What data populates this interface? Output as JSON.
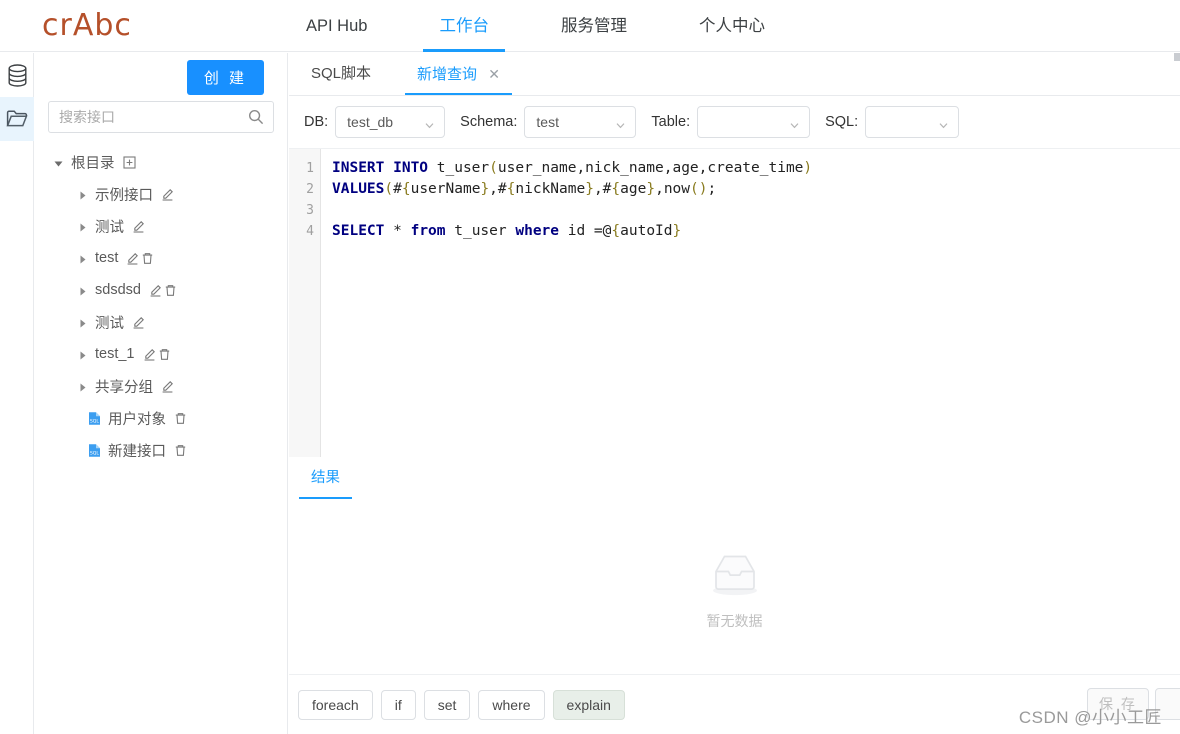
{
  "header": {
    "logo": "crAbc",
    "nav": [
      {
        "label": "API Hub",
        "active": false
      },
      {
        "label": "工作台",
        "active": true
      },
      {
        "label": "服务管理",
        "active": false
      },
      {
        "label": "个人中心",
        "active": false
      }
    ]
  },
  "rail": {
    "items": [
      {
        "icon": "database-icon",
        "active": false
      },
      {
        "icon": "folder-icon",
        "active": true
      }
    ]
  },
  "sidebar": {
    "create_label": "创 建",
    "search": {
      "value": "",
      "placeholder": "搜索接口",
      "icon": "search-icon"
    },
    "tree": [
      {
        "label": "根目录",
        "level": 0,
        "caret": "down",
        "actions": [
          "plus-box-icon"
        ]
      },
      {
        "label": "示例接口",
        "level": 1,
        "caret": "right",
        "actions": [
          "pencil-icon"
        ]
      },
      {
        "label": "测试",
        "level": 1,
        "caret": "right",
        "actions": [
          "pencil-icon"
        ]
      },
      {
        "label": "test",
        "level": 1,
        "caret": "right",
        "actions": [
          "pencil-icon",
          "trash-icon"
        ]
      },
      {
        "label": "sdsdsd",
        "level": 1,
        "caret": "right",
        "actions": [
          "pencil-icon",
          "trash-icon"
        ]
      },
      {
        "label": "测试",
        "level": 1,
        "caret": "right",
        "actions": [
          "pencil-icon"
        ]
      },
      {
        "label": "test_1",
        "level": 1,
        "caret": "right",
        "actions": [
          "pencil-icon",
          "trash-icon"
        ]
      },
      {
        "label": "共享分组",
        "level": 1,
        "caret": "right",
        "actions": [
          "pencil-icon"
        ]
      },
      {
        "label": "用户对象",
        "level": 2,
        "caret": "none",
        "leaf_icon": "sql-file-icon",
        "actions": [
          "trash-icon"
        ]
      },
      {
        "label": "新建接口",
        "level": 2,
        "caret": "none",
        "leaf_icon": "sql-file-icon",
        "actions": [
          "trash-icon"
        ]
      }
    ]
  },
  "main": {
    "tabs": [
      {
        "label": "SQL脚本",
        "active": false,
        "closable": false
      },
      {
        "label": "新增查询",
        "active": true,
        "closable": true,
        "close_icon": "close-icon"
      }
    ],
    "toolbar": {
      "db": {
        "label": "DB:",
        "value": "test_db"
      },
      "schema": {
        "label": "Schema:",
        "value": "test"
      },
      "table": {
        "label": "Table:",
        "value": ""
      },
      "sql": {
        "label": "SQL:",
        "value": ""
      }
    },
    "editor": {
      "line_numbers": [
        "1",
        "2",
        "3",
        "4"
      ],
      "lines": [
        "INSERT INTO t_user(user_name,nick_name,age,create_time)",
        "VALUES(#{userName},#{nickName},#{age},now());",
        "",
        "SELECT * from t_user where id =@{autoId}"
      ]
    },
    "result": {
      "tabs": [
        {
          "label": "结果",
          "active": true
        }
      ],
      "empty_icon": "empty-inbox-icon",
      "empty_text": "暂无数据"
    },
    "bottom": {
      "chips": [
        {
          "label": "foreach",
          "tinted": false
        },
        {
          "label": "if",
          "tinted": false
        },
        {
          "label": "set",
          "tinted": false
        },
        {
          "label": "where",
          "tinted": false
        },
        {
          "label": "explain",
          "tinted": true
        }
      ],
      "save_label": "保 存"
    }
  },
  "watermark": "CSDN @小小工匠",
  "colors": {
    "accent_blue": "#1890ff",
    "tab_blue": "#1a9cfc",
    "logo_orange": "#b5502a",
    "keyword_navy": "#000080",
    "brace_olive": "#8a7c20",
    "rail_active_bg": "#e8f4fd"
  }
}
